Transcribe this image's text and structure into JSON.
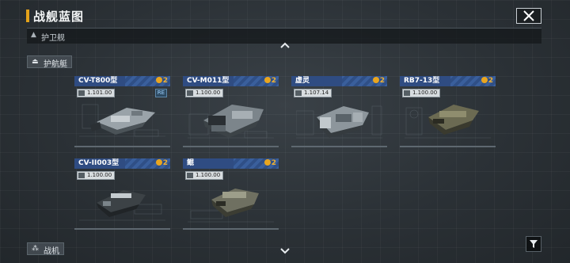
{
  "header": {
    "title": "战舰蓝图"
  },
  "section": {
    "label": "护卫舰"
  },
  "categories": {
    "escort": "护航艇",
    "fighter": "战机"
  },
  "cards": [
    {
      "name": "CV-T800型",
      "cost": "2",
      "version": "1.101.00",
      "tag": "RE"
    },
    {
      "name": "CV-M011型",
      "cost": "2",
      "version": "1.100.00"
    },
    {
      "name": "虚灵",
      "cost": "2",
      "version": "1.107.14"
    },
    {
      "name": "RB7-13型",
      "cost": "2",
      "version": "1.100.00"
    },
    {
      "name": "CV-II003型",
      "cost": "2",
      "version": "1.100.00"
    },
    {
      "name": "鲲",
      "cost": "2",
      "version": "1.100.00"
    }
  ],
  "colors": {
    "accent": "#e3a21a",
    "card_header": "#2f4c82",
    "cost": "#f0b030"
  },
  "icons": [
    "close-icon",
    "chevron-up-icon",
    "chevron-down-icon",
    "filter-icon",
    "coin-icon"
  ]
}
